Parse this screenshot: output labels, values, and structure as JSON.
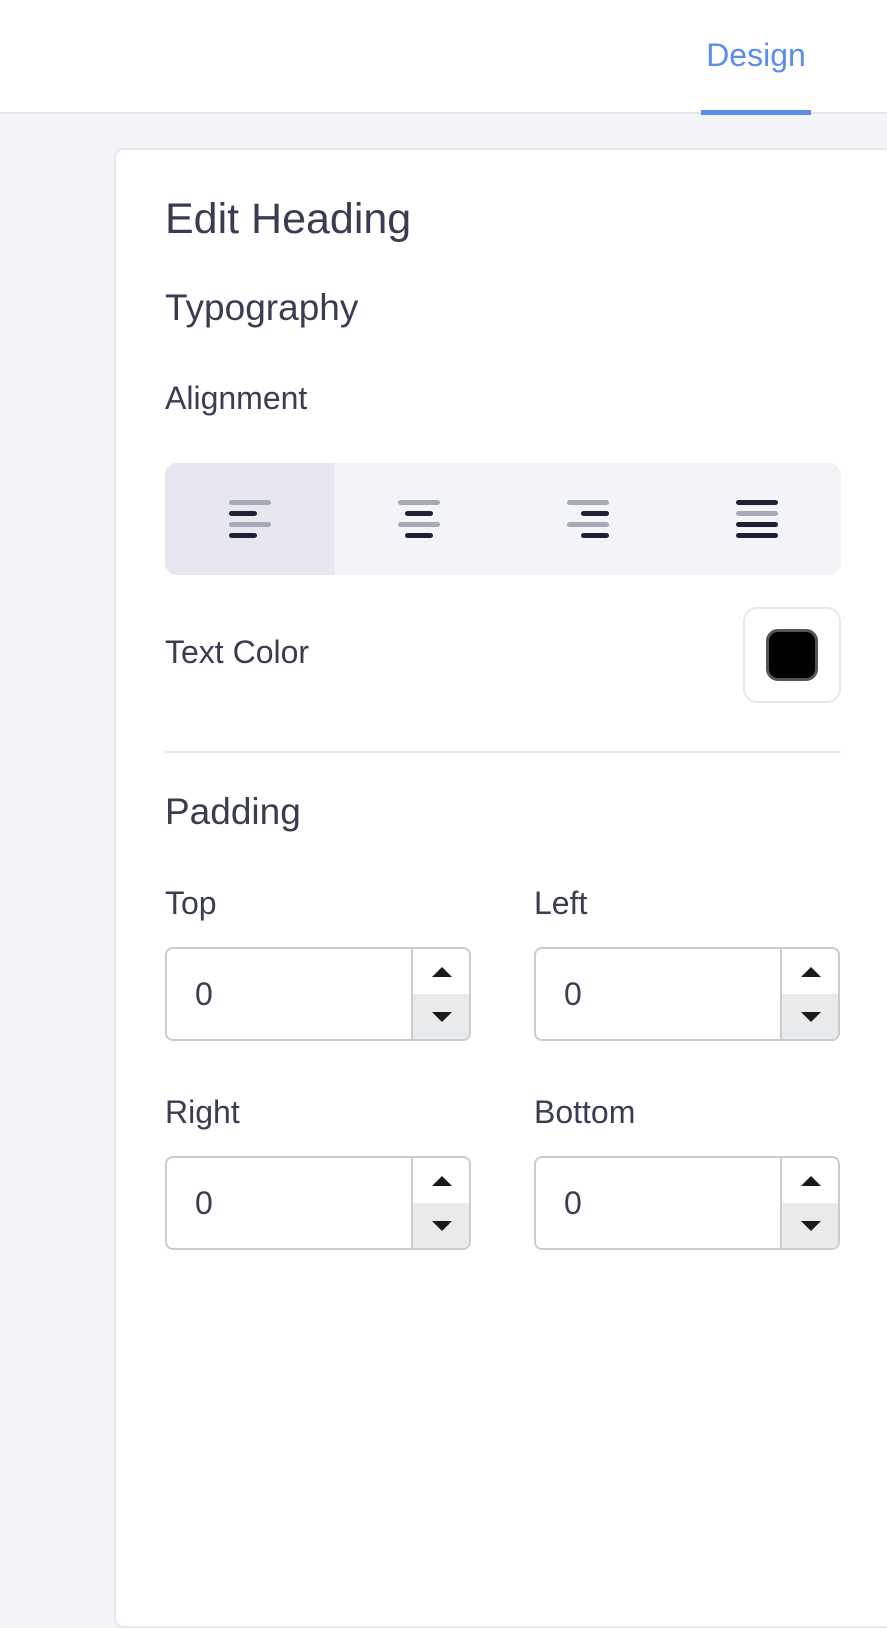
{
  "header": {
    "active_tab": "Design"
  },
  "panel": {
    "title": "Edit Heading",
    "typography": {
      "section_title": "Typography",
      "alignment_label": "Alignment",
      "alignment_options": [
        {
          "icon": "align-left-icon",
          "selected": true
        },
        {
          "icon": "align-center-icon",
          "selected": false
        },
        {
          "icon": "align-right-icon",
          "selected": false
        },
        {
          "icon": "align-justify-icon",
          "selected": false
        }
      ],
      "text_color_label": "Text Color",
      "text_color_value": "#000000"
    },
    "padding": {
      "section_title": "Padding",
      "top_label": "Top",
      "top_value": "0",
      "left_label": "Left",
      "left_value": "0",
      "right_label": "Right",
      "right_value": "0",
      "bottom_label": "Bottom",
      "bottom_value": "0"
    }
  },
  "colors": {
    "accent": "#5b8def",
    "text": "#3a3d52",
    "background": "#f2f4f7"
  }
}
